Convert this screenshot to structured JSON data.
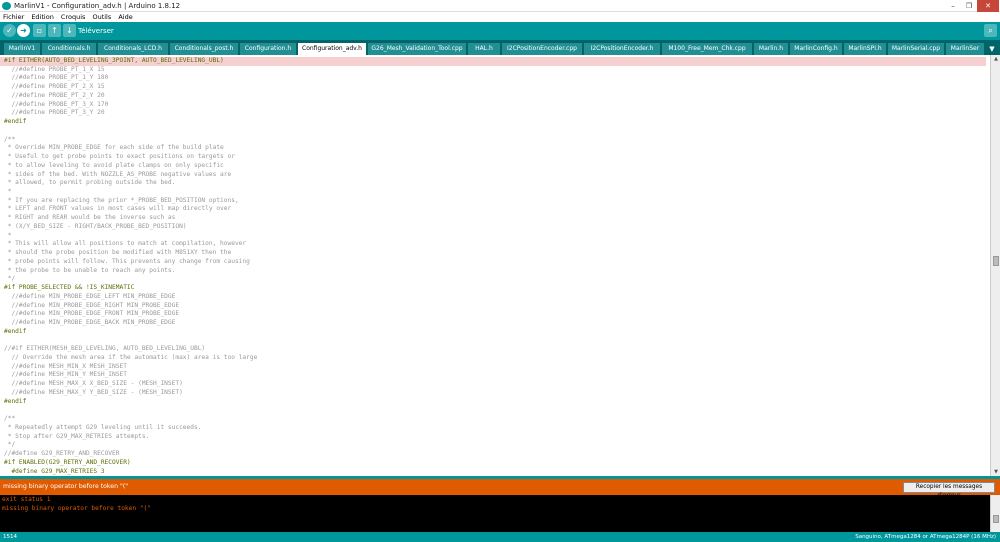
{
  "window": {
    "title": "MarlinV1 - Configuration_adv.h | Arduino 1.8.12",
    "minimize": "–",
    "maximize": "❐",
    "close": "✕"
  },
  "menu": [
    "Fichier",
    "Edition",
    "Croquis",
    "Outils",
    "Aide"
  ],
  "toolbar": {
    "verify_icon": "check-icon",
    "upload_icon": "arrow-right-icon",
    "new_icon": "new-file-icon",
    "open_icon": "open-icon",
    "save_icon": "save-icon",
    "hover_label": "Téléverser",
    "serial_monitor_icon": "magnifier-icon"
  },
  "tabs": [
    "MarlinV1",
    "Conditionals.h",
    "Conditionals_LCD.h",
    "Conditionals_post.h",
    "Configuration.h",
    "Configuration_adv.h",
    "G26_Mesh_Validation_Tool.cpp",
    "HAL.h",
    "I2CPositionEncoder.cpp",
    "I2CPositionEncoder.h",
    "M100_Free_Mem_Chk.cpp",
    "Marlin.h",
    "MarlinConfig.h",
    "MarlinSPI.h",
    "MarlinSerial.cpp",
    "MarlinSer"
  ],
  "active_tab": "Configuration_adv.h",
  "tab_menu_icon": "▼",
  "code_lines": [
    "#if EITHER(AUTO_BED_LEVELING_3POINT, AUTO_BED_LEVELING_UBL)",
    "  //#define PROBE_PT_1_X 15",
    "  //#define PROBE_PT_1_Y 180",
    "  //#define PROBE_PT_2_X 15",
    "  //#define PROBE_PT_2_Y 20",
    "  //#define PROBE_PT_3_X 170",
    "  //#define PROBE_PT_3_Y 20",
    "#endif",
    "",
    "/**",
    " * Override MIN_PROBE_EDGE for each side of the build plate",
    " * Useful to get probe points to exact positions on targets or",
    " * to allow leveling to avoid plate clamps on only specific",
    " * sides of the bed. With NOZZLE_AS_PROBE negative values are",
    " * allowed, to permit probing outside the bed.",
    " *",
    " * If you are replacing the prior *_PROBE_BED_POSITION options,",
    " * LEFT and FRONT values in most cases will map directly over",
    " * RIGHT and REAR would be the inverse such as",
    " * (X/Y_BED_SIZE - RIGHT/BACK_PROBE_BED_POSITION)",
    " *",
    " * This will allow all positions to match at compilation, however",
    " * should the probe position be modified with M851XY then the",
    " * probe points will follow. This prevents any change from causing",
    " * the probe to be unable to reach any points.",
    " */",
    "#if PROBE_SELECTED && !IS_KINEMATIC",
    "  //#define MIN_PROBE_EDGE_LEFT MIN_PROBE_EDGE",
    "  //#define MIN_PROBE_EDGE_RIGHT MIN_PROBE_EDGE",
    "  //#define MIN_PROBE_EDGE_FRONT MIN_PROBE_EDGE",
    "  //#define MIN_PROBE_EDGE_BACK MIN_PROBE_EDGE",
    "#endif",
    "",
    "//#if EITHER(MESH_BED_LEVELING, AUTO_BED_LEVELING_UBL)",
    "  // Override the mesh area if the automatic (max) area is too large",
    "  //#define MESH_MIN_X MESH_INSET",
    "  //#define MESH_MIN_Y MESH_INSET",
    "  //#define MESH_MAX_X X_BED_SIZE - (MESH_INSET)",
    "  //#define MESH_MAX_Y Y_BED_SIZE - (MESH_INSET)",
    "#endif",
    "",
    "/**",
    " * Repeatedly attempt G29 leveling until it succeeds.",
    " * Stop after G29_MAX_RETRIES attempts.",
    " */",
    "//#define G29_RETRY_AND_RECOVER",
    "#if ENABLED(G29_RETRY_AND_RECOVER)",
    "  #define G29_MAX_RETRIES 3"
  ],
  "error": {
    "message": "missing binary operator before token \"(\"",
    "copy_button": "Recopier les messages d'erreur"
  },
  "console_lines": [
    "exit status 1",
    "missing binary operator before token \"(\""
  ],
  "status": {
    "line_number": "1514",
    "board": "Sanguino, ATmega1284 or ATmega1284P (16 MHz)"
  },
  "colors": {
    "teal": "#00979c",
    "dark_teal": "#006468",
    "error_orange": "#e05a00",
    "highlight": "#f6d0d0"
  }
}
